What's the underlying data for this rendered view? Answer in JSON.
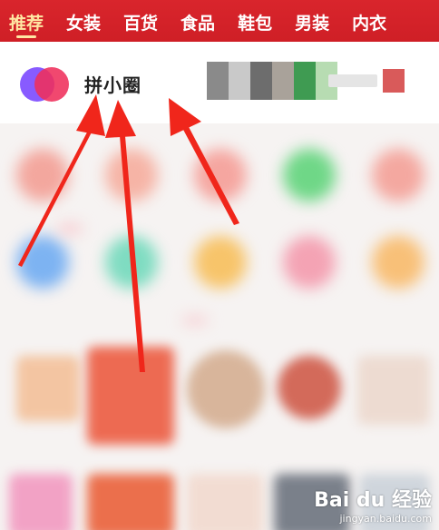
{
  "tabs": [
    {
      "label": "推荐"
    },
    {
      "label": "女装"
    },
    {
      "label": "百货"
    },
    {
      "label": "食品"
    },
    {
      "label": "鞋包"
    },
    {
      "label": "男装"
    },
    {
      "label": "内衣"
    }
  ],
  "circle": {
    "name": "拼小圈"
  },
  "watermark": {
    "main": "Bai du 经验",
    "sub": "jingyan.baidu.com"
  },
  "colors": {
    "topbar": "#d9252c",
    "active_tab": "#ffe6a3",
    "arrow": "#f0261b"
  }
}
